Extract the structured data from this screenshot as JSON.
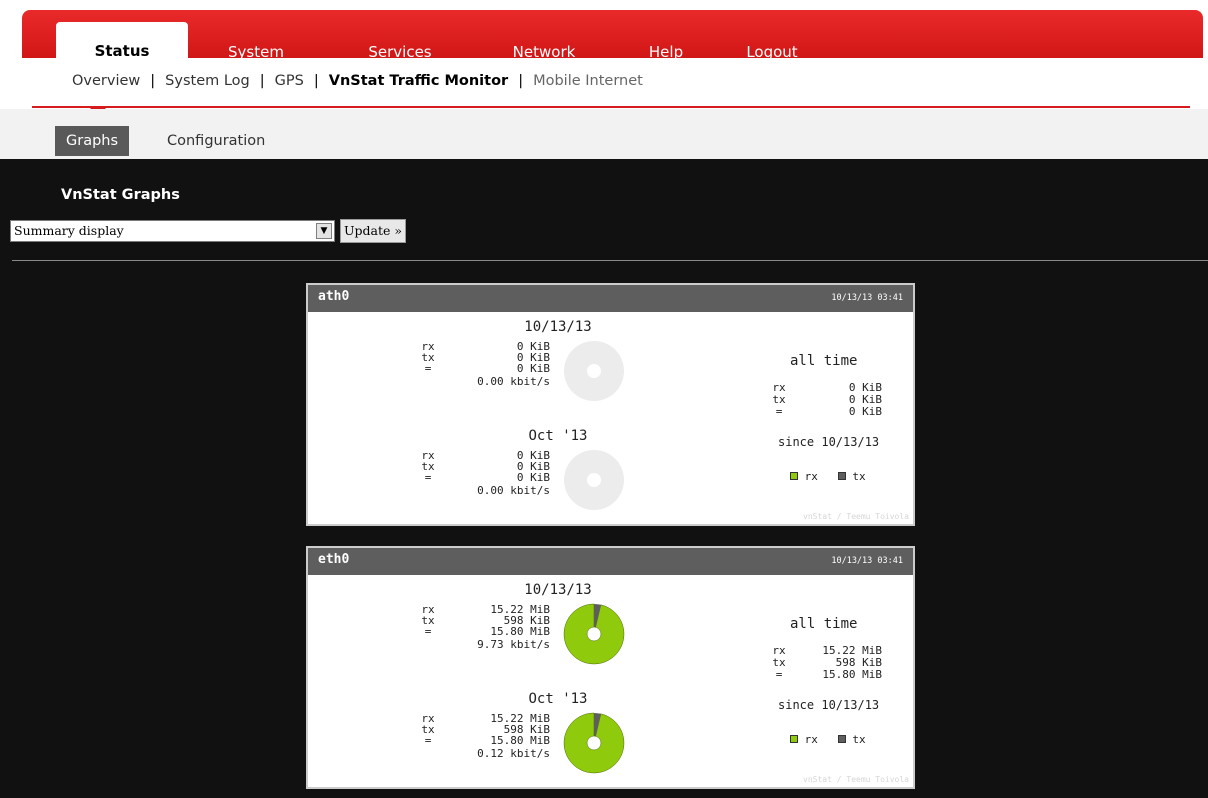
{
  "top_nav": {
    "tabs": [
      {
        "label": "Status",
        "active": true
      },
      {
        "label": "System"
      },
      {
        "label": "Services"
      },
      {
        "label": "Network"
      },
      {
        "label": "Help"
      },
      {
        "label": "Logout"
      }
    ]
  },
  "sub_nav": {
    "items": [
      "Overview",
      "System Log",
      "GPS",
      "VnStat Traffic Monitor",
      "Mobile Internet"
    ],
    "current": "VnStat Traffic Monitor"
  },
  "tertiary_nav": {
    "tabs": [
      "Graphs",
      "Configuration"
    ],
    "active": "Graphs"
  },
  "page": {
    "heading": "VnStat Graphs",
    "display_select": {
      "value": "Summary display"
    },
    "update_button": "Update »"
  },
  "colors": {
    "brand_red": "#d51b1b",
    "rx_green": "#8fca0d",
    "tx_gray": "#5e5e5e",
    "empty_pie": "#ececec"
  },
  "panels": [
    {
      "interface": "ath0",
      "timestamp": "10/13/13 03:41",
      "today": {
        "title": "10/13/13",
        "rows": [
          {
            "label": "rx",
            "value": "0 KiB"
          },
          {
            "label": "tx",
            "value": "0 KiB"
          },
          {
            "label": "=",
            "value": "0 KiB"
          }
        ],
        "rate": "0.00 kbit/s",
        "rx_fraction": 0
      },
      "month": {
        "title": "Oct '13",
        "rows": [
          {
            "label": "rx",
            "value": "0 KiB"
          },
          {
            "label": "tx",
            "value": "0 KiB"
          },
          {
            "label": "=",
            "value": "0 KiB"
          }
        ],
        "rate": "0.00 kbit/s",
        "rx_fraction": 0
      },
      "all_time": {
        "title": "all time",
        "rows": [
          {
            "label": "rx",
            "value": "0 KiB"
          },
          {
            "label": "tx",
            "value": "0 KiB"
          },
          {
            "label": "=",
            "value": "0 KiB"
          }
        ],
        "since": "since 10/13/13"
      },
      "legend": {
        "rx": "rx",
        "tx": "tx"
      },
      "credit": "vnStat / Teemu Toivola"
    },
    {
      "interface": "eth0",
      "timestamp": "10/13/13 03:41",
      "today": {
        "title": "10/13/13",
        "rows": [
          {
            "label": "rx",
            "value": "15.22 MiB"
          },
          {
            "label": "tx",
            "value": "598 KiB"
          },
          {
            "label": "=",
            "value": "15.80 MiB"
          }
        ],
        "rate": "9.73 kbit/s",
        "rx_fraction": 0.963
      },
      "month": {
        "title": "Oct '13",
        "rows": [
          {
            "label": "rx",
            "value": "15.22 MiB"
          },
          {
            "label": "tx",
            "value": "598 KiB"
          },
          {
            "label": "=",
            "value": "15.80 MiB"
          }
        ],
        "rate": "0.12 kbit/s",
        "rx_fraction": 0.963
      },
      "all_time": {
        "title": "all time",
        "rows": [
          {
            "label": "rx",
            "value": "15.22 MiB"
          },
          {
            "label": "tx",
            "value": "598 KiB"
          },
          {
            "label": "=",
            "value": "15.80 MiB"
          }
        ],
        "since": "since 10/13/13"
      },
      "legend": {
        "rx": "rx",
        "tx": "tx"
      },
      "credit": "vnStat / Teemu Toivola"
    }
  ]
}
